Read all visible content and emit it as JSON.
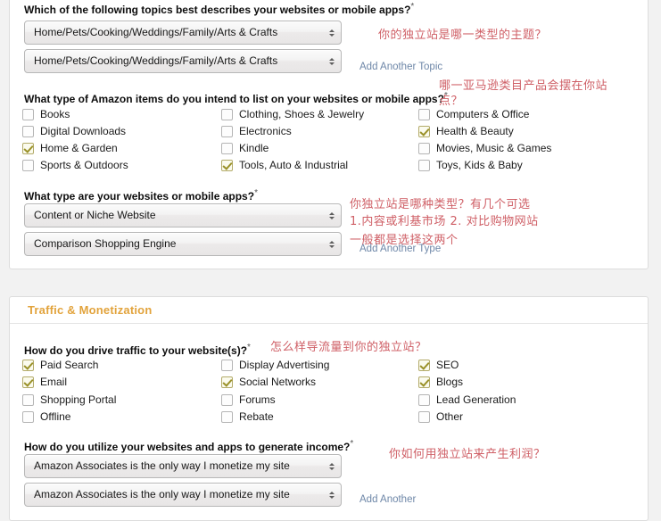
{
  "panels": {
    "topics": {
      "questions": {
        "topic": "Which of the following topics best describes your websites or mobile apps?",
        "items": "What type of Amazon items do you intend to list on your websites or mobile apps?",
        "type": "What type are your websites or mobile apps?"
      },
      "topic_selects": [
        "Home/Pets/Cooking/Weddings/Family/Arts & Crafts",
        "Home/Pets/Cooking/Weddings/Family/Arts & Crafts"
      ],
      "type_selects": [
        "Content or Niche Website",
        "Comparison Shopping Engine"
      ],
      "links": {
        "add_topic": "Add Another Topic",
        "add_type": "Add Another Type"
      },
      "item_checkboxes": [
        {
          "label": "Books",
          "checked": false
        },
        {
          "label": "Digital Downloads",
          "checked": false
        },
        {
          "label": "Home & Garden",
          "checked": true
        },
        {
          "label": "Sports & Outdoors",
          "checked": false
        },
        {
          "label": "Clothing, Shoes & Jewelry",
          "checked": false
        },
        {
          "label": "Electronics",
          "checked": false
        },
        {
          "label": "Kindle",
          "checked": false
        },
        {
          "label": "Tools, Auto & Industrial",
          "checked": true
        },
        {
          "label": "Computers & Office",
          "checked": false
        },
        {
          "label": "Health & Beauty",
          "checked": true
        },
        {
          "label": "Movies, Music & Games",
          "checked": false
        },
        {
          "label": "Toys, Kids & Baby",
          "checked": false
        }
      ]
    },
    "traffic": {
      "header": "Traffic & Monetization",
      "questions": {
        "drive": "How do you drive traffic to your website(s)?",
        "income": "How do you utilize your websites and apps to generate income?"
      },
      "traffic_checkboxes": [
        {
          "label": "Paid Search",
          "checked": true
        },
        {
          "label": "Email",
          "checked": true
        },
        {
          "label": "Shopping Portal",
          "checked": false
        },
        {
          "label": "Offline",
          "checked": false
        },
        {
          "label": "Display Advertising",
          "checked": false
        },
        {
          "label": "Social Networks",
          "checked": true
        },
        {
          "label": "Forums",
          "checked": false
        },
        {
          "label": "Rebate",
          "checked": false
        },
        {
          "label": "SEO",
          "checked": true
        },
        {
          "label": "Blogs",
          "checked": true
        },
        {
          "label": "Lead Generation",
          "checked": false
        },
        {
          "label": "Other",
          "checked": false
        }
      ],
      "income_selects": [
        "Amazon Associates is the only way I monetize my site",
        "Amazon Associates is the only way I monetize my site"
      ],
      "links": {
        "add_another": "Add Another"
      }
    }
  },
  "required_marker": "*",
  "annotations": {
    "topic": "你的独立站是哪一类型的主题？",
    "items_line1": "哪一亚马逊类目产品会摆在你站",
    "items_line2": "点？",
    "type_line1": "你独立站是哪种类型？有几个可选",
    "type_line2": "1.内容或利基市场 2. 对比购物网站",
    "type_line3": "一般都是选择这两个",
    "drive": "怎么样导流量到你的独立站？",
    "income": "你如何用独立站来产生利润？"
  },
  "colors": {
    "accent": "#e2a33c",
    "annotation": "#cf5f66",
    "link": "#6e87a8",
    "checked": "#9a9129"
  }
}
